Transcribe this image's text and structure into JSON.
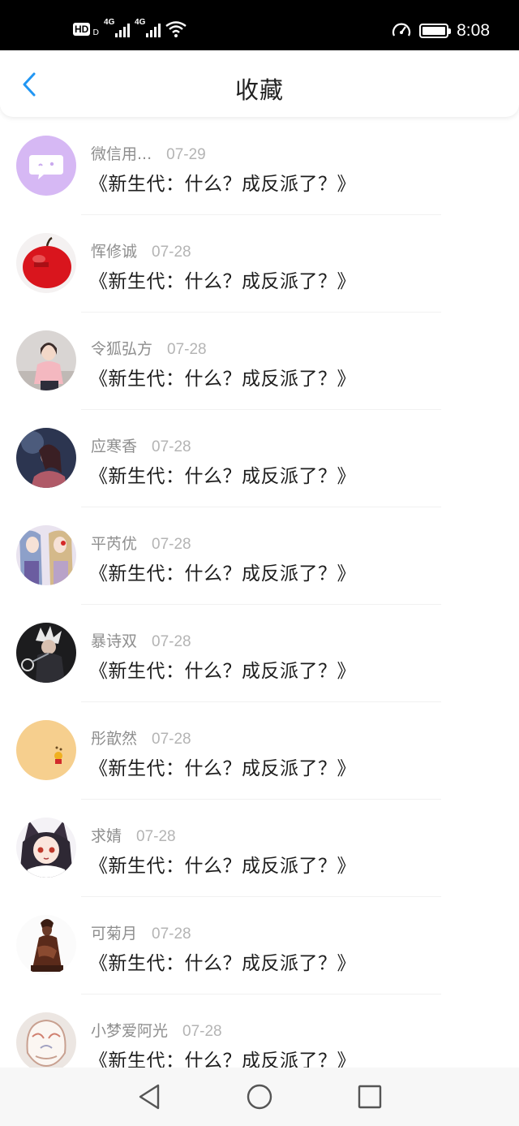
{
  "status_bar": {
    "hd": "HD",
    "hd_sub": "D",
    "signal1": "4G",
    "signal2": "4G",
    "time": "8:08"
  },
  "header": {
    "title": "收藏",
    "accent_color": "#2196f3"
  },
  "favorites": [
    {
      "user": "微信用...",
      "date": "07-29",
      "title": "《新生代：什么？成反派了？》",
      "avatar": "wechat-bubble-icon"
    },
    {
      "user": "恽修诚",
      "date": "07-28",
      "title": "《新生代：什么？成反派了？》",
      "avatar": "red-apple-photo"
    },
    {
      "user": "令狐弘方",
      "date": "07-28",
      "title": "《新生代：什么？成反派了？》",
      "avatar": "girl-pink-photo"
    },
    {
      "user": "应寒香",
      "date": "07-28",
      "title": "《新生代：什么？成反派了？》",
      "avatar": "dark-portrait-photo"
    },
    {
      "user": "平芮优",
      "date": "07-28",
      "title": "《新生代：什么？成反派了？》",
      "avatar": "anime-duo-photo"
    },
    {
      "user": "暴诗双",
      "date": "07-28",
      "title": "《新生代：什么？成反派了？》",
      "avatar": "anime-white-hair-photo"
    },
    {
      "user": "彤歆然",
      "date": "07-28",
      "title": "《新生代：什么？成反派了？》",
      "avatar": "cartoon-bear-photo"
    },
    {
      "user": "求婧",
      "date": "07-28",
      "title": "《新生代：什么？成反派了？》",
      "avatar": "anime-catgirl-photo"
    },
    {
      "user": "可菊月",
      "date": "07-28",
      "title": "《新生代：什么？成反派了？》",
      "avatar": "statue-photo"
    },
    {
      "user": "小梦爱阿光",
      "date": "07-28",
      "title": "《新生代：什么？成反派了？》",
      "avatar": "mask-photo"
    }
  ],
  "nav_bar": {
    "back": "triangle-back-icon",
    "home": "circle-home-icon",
    "recents": "square-recents-icon"
  }
}
